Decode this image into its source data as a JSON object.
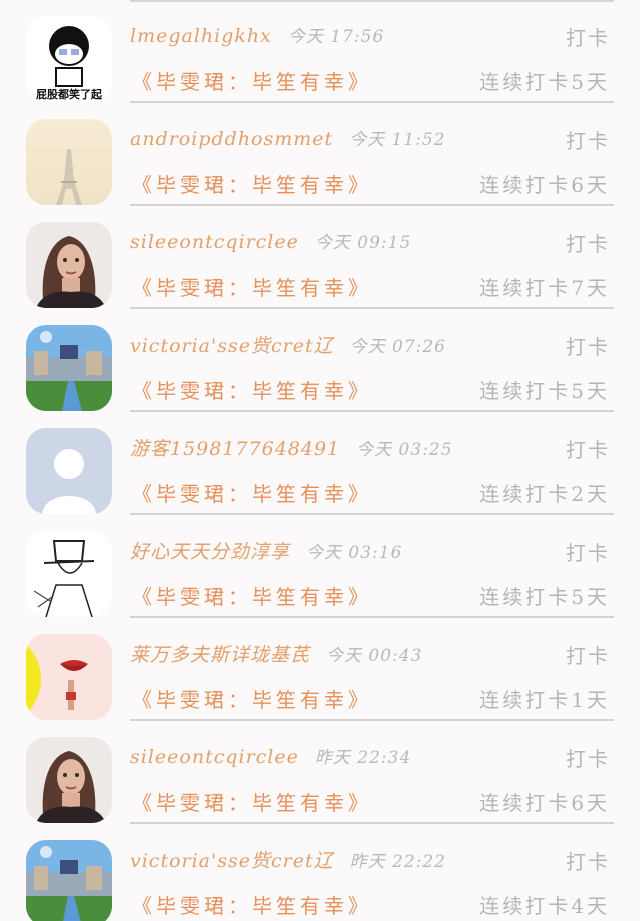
{
  "feed": {
    "items": [
      {
        "avatar": "meme-cartoon-avatar",
        "avatar_text": "屁股都笑了起",
        "username": "lmegalhigkhx",
        "time": "今天 17:56",
        "action": "打卡",
        "book": "《毕雯珺：毕笙有幸》",
        "streak": "连续打卡5天"
      },
      {
        "avatar": "eiffel-tower-avatar",
        "username": "androipddhosmmet",
        "time": "今天 11:52",
        "action": "打卡",
        "book": "《毕雯珺：毕笙有幸》",
        "streak": "连续打卡6天"
      },
      {
        "avatar": "woman-portrait-avatar",
        "username": "sileeontcqirclee",
        "time": "今天 09:15",
        "action": "打卡",
        "book": "《毕雯珺：毕笙有幸》",
        "streak": "连续打卡7天"
      },
      {
        "avatar": "painting-avatar",
        "username": "victoria'sse赀cret辽",
        "time": "今天 07:26",
        "action": "打卡",
        "book": "《毕雯珺：毕笙有幸》",
        "streak": "连续打卡5天"
      },
      {
        "avatar": "default-user-avatar",
        "username": "游客1598177648491",
        "time": "今天 03:25",
        "action": "打卡",
        "book": "《毕雯珺：毕笙有幸》",
        "streak": "连续打卡2天"
      },
      {
        "avatar": "sketch-character-avatar",
        "username": "好心天天分劲淳享",
        "time": "今天 03:16",
        "action": "打卡",
        "book": "《毕雯珺：毕笙有幸》",
        "streak": "连续打卡5天"
      },
      {
        "avatar": "lips-illustration-avatar",
        "username": "莱万多夫斯详珑基芪",
        "time": "今天 00:43",
        "action": "打卡",
        "book": "《毕雯珺：毕笙有幸》",
        "streak": "连续打卡1天"
      },
      {
        "avatar": "woman-portrait-avatar",
        "username": "sileeontcqirclee",
        "time": "昨天 22:34",
        "action": "打卡",
        "book": "《毕雯珺：毕笙有幸》",
        "streak": "连续打卡6天"
      },
      {
        "avatar": "painting-avatar",
        "username": "victoria'sse赀cret辽",
        "time": "昨天 22:22",
        "action": "打卡",
        "book": "《毕雯珺：毕笙有幸》",
        "streak": "连续打卡4天"
      }
    ]
  }
}
